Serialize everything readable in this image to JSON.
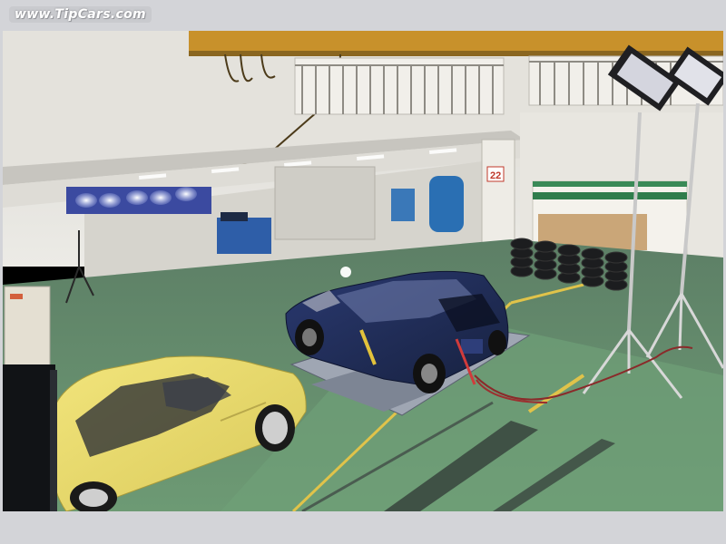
{
  "watermark": {
    "text": "www.TipCars.com"
  },
  "photo": {
    "subject": "Car crash test facility with yellow car, dark blue car on sled plate, lighting rigs and tire stack"
  },
  "sign": {
    "number": "22"
  },
  "colors": {
    "frame_bg": "#d3d4d8",
    "floor_green": "#5f8f68",
    "yellow_car": "#e7d86a",
    "blue_car": "#1f2b55",
    "wall": "#e9e6df"
  }
}
